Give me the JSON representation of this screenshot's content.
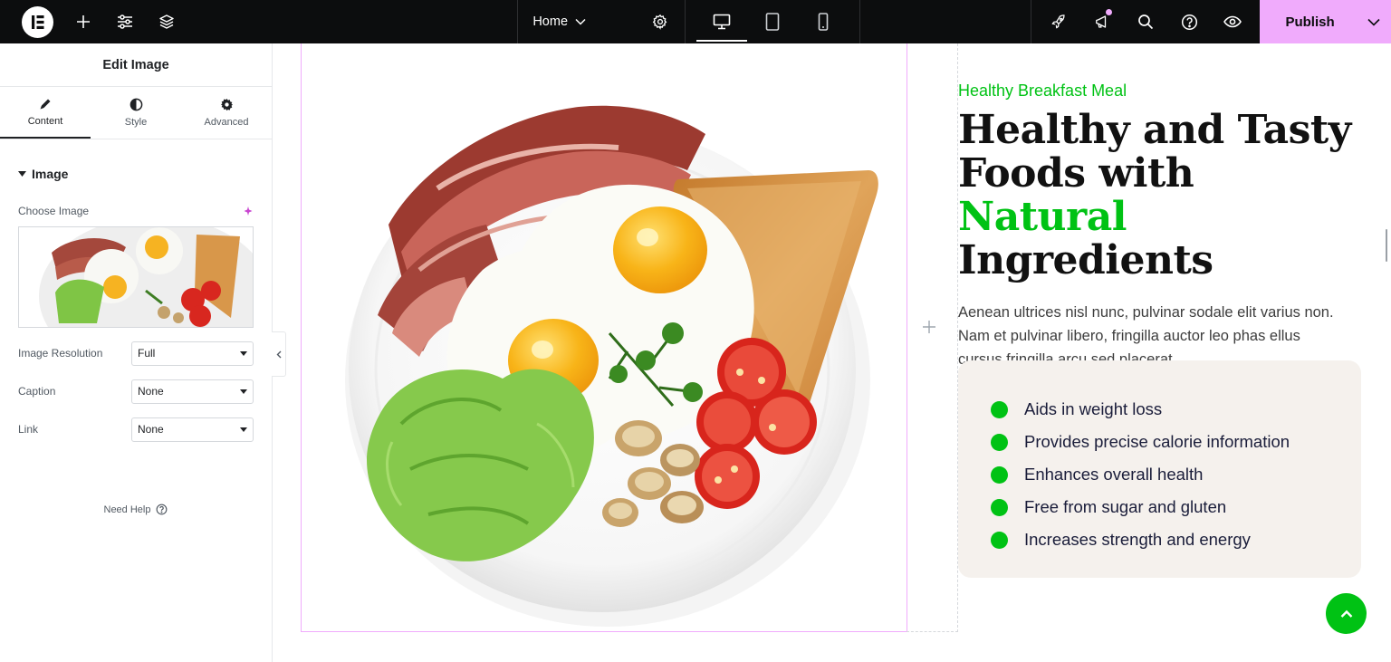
{
  "topbar": {
    "page_label": "Home",
    "publish_label": "Publish",
    "colors": {
      "bg": "#0c0d0e",
      "publish": "#f0abfc"
    }
  },
  "panel": {
    "title": "Edit Image",
    "tabs": [
      {
        "label": "Content",
        "icon": "pencil-icon",
        "active": true
      },
      {
        "label": "Style",
        "icon": "half-circle-icon",
        "active": false
      },
      {
        "label": "Advanced",
        "icon": "gear-icon",
        "active": false
      }
    ],
    "section_title": "Image",
    "choose_image_label": "Choose Image",
    "fields": [
      {
        "label": "Image Resolution",
        "value": "Full"
      },
      {
        "label": "Caption",
        "value": "None"
      },
      {
        "label": "Link",
        "value": "None"
      }
    ],
    "need_help": "Need Help"
  },
  "content": {
    "eyebrow": "Healthy Breakfast Meal",
    "headline_line1": "Healthy and Tasty",
    "headline_line2a": "Foods with ",
    "headline_accent": "Natural",
    "headline_line3": "Ingredients",
    "description": "Aenean ultrices nisl nunc, pulvinar sodale elit varius non. Nam et pulvinar libero, fringilla auctor leo phas ellus cursus fringilla arcu sed placerat.",
    "features": [
      "Aids in weight loss",
      "Provides precise calorie information",
      "Enhances overall health",
      "Free from sugar and gluten",
      "Increases strength and energy"
    ],
    "colors": {
      "accent": "#00c214",
      "feature_box": "#f5f1ed"
    }
  }
}
